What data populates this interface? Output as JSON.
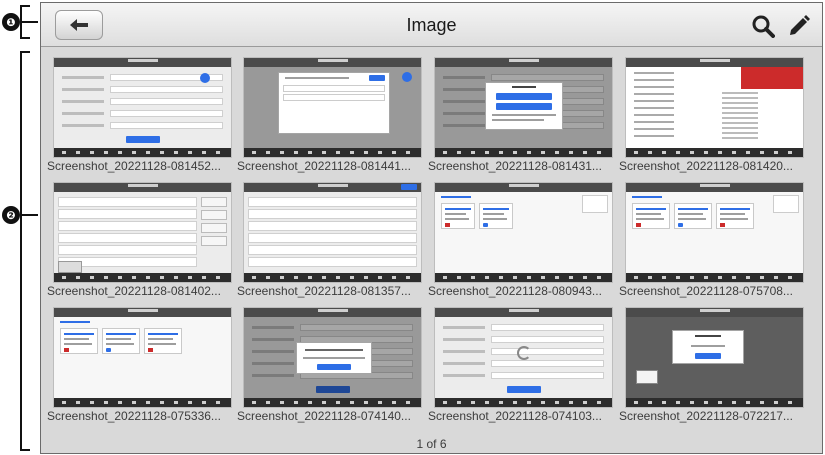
{
  "callouts": [
    "❶",
    "❷"
  ],
  "header": {
    "title": "Image",
    "back_icon": "back-arrow-icon",
    "search_icon": "search-icon",
    "edit_icon": "pencil-icon"
  },
  "gallery": {
    "items": [
      {
        "caption": "Screenshot_20221128-081452...",
        "preview": "form"
      },
      {
        "caption": "Screenshot_20221128-081441...",
        "preview": "dialog-list"
      },
      {
        "caption": "Screenshot_20221128-081431...",
        "preview": "dialog-buttons"
      },
      {
        "caption": "Screenshot_20221128-081420...",
        "preview": "document"
      },
      {
        "caption": "Screenshot_20221128-081402...",
        "preview": "table-side"
      },
      {
        "caption": "Screenshot_20221128-081357...",
        "preview": "table-form"
      },
      {
        "caption": "Screenshot_20221128-080943...",
        "preview": "cards"
      },
      {
        "caption": "Screenshot_20221128-075708...",
        "preview": "cards-wide"
      },
      {
        "caption": "Screenshot_20221128-075336...",
        "preview": "cards-small"
      },
      {
        "caption": "Screenshot_20221128-074140...",
        "preview": "form-dialog"
      },
      {
        "caption": "Screenshot_20221128-074103...",
        "preview": "form-loading"
      },
      {
        "caption": "Screenshot_20221128-072217...",
        "preview": "dark-dialog"
      }
    ]
  },
  "pager": {
    "text": "1 of 6",
    "current": 1,
    "total": 6
  }
}
